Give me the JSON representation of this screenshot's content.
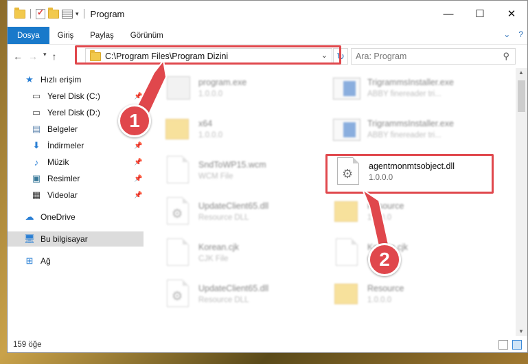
{
  "window": {
    "title": "Program"
  },
  "ribbon": {
    "tabs": [
      "Dosya",
      "Giriş",
      "Paylaş",
      "Görünüm"
    ],
    "help": "?"
  },
  "controls": {
    "minimize": "—",
    "maximize": "☐",
    "close": "✕"
  },
  "address": {
    "path": "C:\\Program Files\\Program Dizini"
  },
  "search": {
    "placeholder": "Ara: Program"
  },
  "sidebar": {
    "items": [
      {
        "label": "Hızlı erişim",
        "icon": "star-icon"
      },
      {
        "label": "Yerel Disk (C:)",
        "icon": "drive-icon",
        "pinned": true
      },
      {
        "label": "Yerel Disk (D:)",
        "icon": "drive-icon"
      },
      {
        "label": "Belgeler",
        "icon": "documents-icon",
        "pinned": true
      },
      {
        "label": "İndirmeler",
        "icon": "download-icon",
        "pinned": true
      },
      {
        "label": "Müzik",
        "icon": "music-icon",
        "pinned": true
      },
      {
        "label": "Resimler",
        "icon": "pictures-icon",
        "pinned": true
      },
      {
        "label": "Videolar",
        "icon": "videos-icon",
        "pinned": true
      },
      {
        "label": "OneDrive",
        "icon": "cloud-icon"
      },
      {
        "label": "Bu bilgisayar",
        "icon": "computer-icon",
        "selected": true
      },
      {
        "label": "Ağ",
        "icon": "network-icon"
      }
    ]
  },
  "files": [
    {
      "name": "program.exe",
      "sub": "1.0.0.0",
      "type": "exe"
    },
    {
      "name": "TrigrammsInstaller.exe",
      "sub": "ABBY finereader tri...",
      "type": "installer"
    },
    {
      "name": "x64",
      "sub": "1.0.0.0",
      "type": "folder"
    },
    {
      "name": "TrigrammsInstaller.exe",
      "sub": "ABBY finereader tri...",
      "type": "installer"
    },
    {
      "name": "SndToWP15.wcm",
      "sub": "WCM File",
      "type": "doc"
    },
    {
      "name": "agentmonmtsobject.dll",
      "sub": "1.0.0.0",
      "type": "dll",
      "highlight": true
    },
    {
      "name": "UpdateClient65.dll",
      "sub": "Resource DLL",
      "type": "dll"
    },
    {
      "name": "Resource",
      "sub": "1.0.0.0",
      "type": "folder"
    },
    {
      "name": "Korean.cjk",
      "sub": "CJK File",
      "type": "doc"
    },
    {
      "name": "Korean.cjk",
      "sub": "CJK File",
      "type": "doc"
    },
    {
      "name": "UpdateClient65.dll",
      "sub": "Resource DLL",
      "type": "dll"
    },
    {
      "name": "Resource",
      "sub": "1.0.0.0",
      "type": "folder"
    }
  ],
  "markers": [
    "1",
    "2"
  ],
  "status": {
    "count": "159 öğe"
  },
  "colors": {
    "accent": "#1979ca",
    "highlight": "#e0474c"
  }
}
